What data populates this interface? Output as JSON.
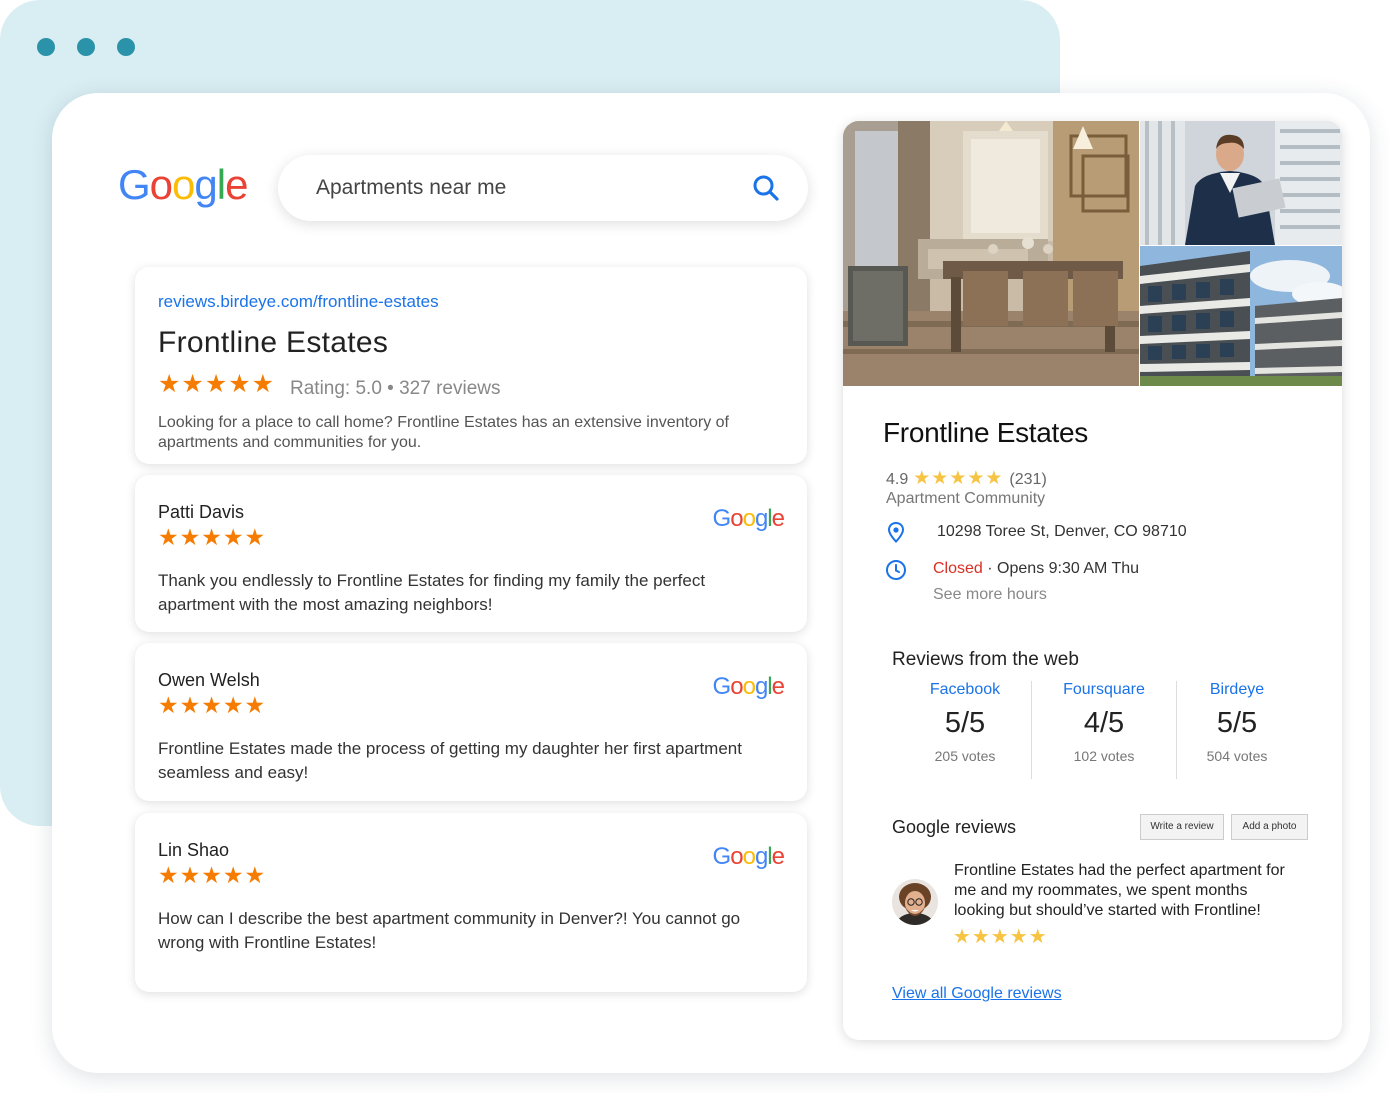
{
  "search": {
    "logo": [
      "G",
      "o",
      "o",
      "g",
      "l",
      "e"
    ],
    "query": "Apartments near me"
  },
  "listing": {
    "url": "reviews.birdeye.com/frontline-estates",
    "title": "Frontline Estates",
    "stars": "★★★★★",
    "rating_text": "Rating: 5.0 • 327 reviews",
    "description": "Looking for a place to call home? Frontline Estates has an extensive inventory of apartments and communities for you."
  },
  "reviews": [
    {
      "name": "Patti Davis",
      "stars": "★★★★★",
      "text": "Thank you endlessly to Frontline Estates for finding my family the perfect apartment with the most amazing neighbors!"
    },
    {
      "name": "Owen Welsh",
      "stars": "★★★★★",
      "text": "Frontline Estates made the process of getting my daughter her first apartment seamless and easy!"
    },
    {
      "name": "Lin Shao",
      "stars": "★★★★★",
      "text": "How can I describe the best apartment community in Denver?! You cannot go wrong with Frontline Estates!"
    }
  ],
  "panel": {
    "title": "Frontline Estates",
    "rating": "4.9",
    "stars": "★★★★★",
    "count": "(231)",
    "type": "Apartment Community",
    "address": "10298 Toree St, Denver, CO 98710",
    "status": "Closed",
    "separator": "·",
    "opens": "Opens 9:30 AM Thu",
    "see_more": "See more hours",
    "web_title": "Reviews from the web",
    "web": [
      {
        "source": "Facebook",
        "score": "5/5",
        "votes": "205 votes"
      },
      {
        "source": "Foursquare",
        "score": "4/5",
        "votes": "102 votes"
      },
      {
        "source": "Birdeye",
        "score": "5/5",
        "votes": "504 votes"
      }
    ],
    "google_reviews_title": "Google reviews",
    "write_review": "Write a review",
    "add_photo": "Add a photo",
    "featured_review": {
      "text": "Frontline Estates had the perfect apartment for me and my roommates, we spent months looking but should’ve started with Frontline!",
      "stars": "★★★★★"
    },
    "view_all": "View all Google reviews"
  },
  "colors": {
    "google_blue": "#4285F4",
    "google_red": "#EA4335",
    "google_yellow": "#FBBC05",
    "google_green": "#34A853",
    "link": "#1a73e8",
    "review_stars": "#f57c00",
    "panel_stars": "#f6c343",
    "closed": "#d93025",
    "back_window": "#d9eef3"
  },
  "icons": {
    "search": "search-icon",
    "location": "location-pin-icon",
    "clock": "clock-icon"
  }
}
